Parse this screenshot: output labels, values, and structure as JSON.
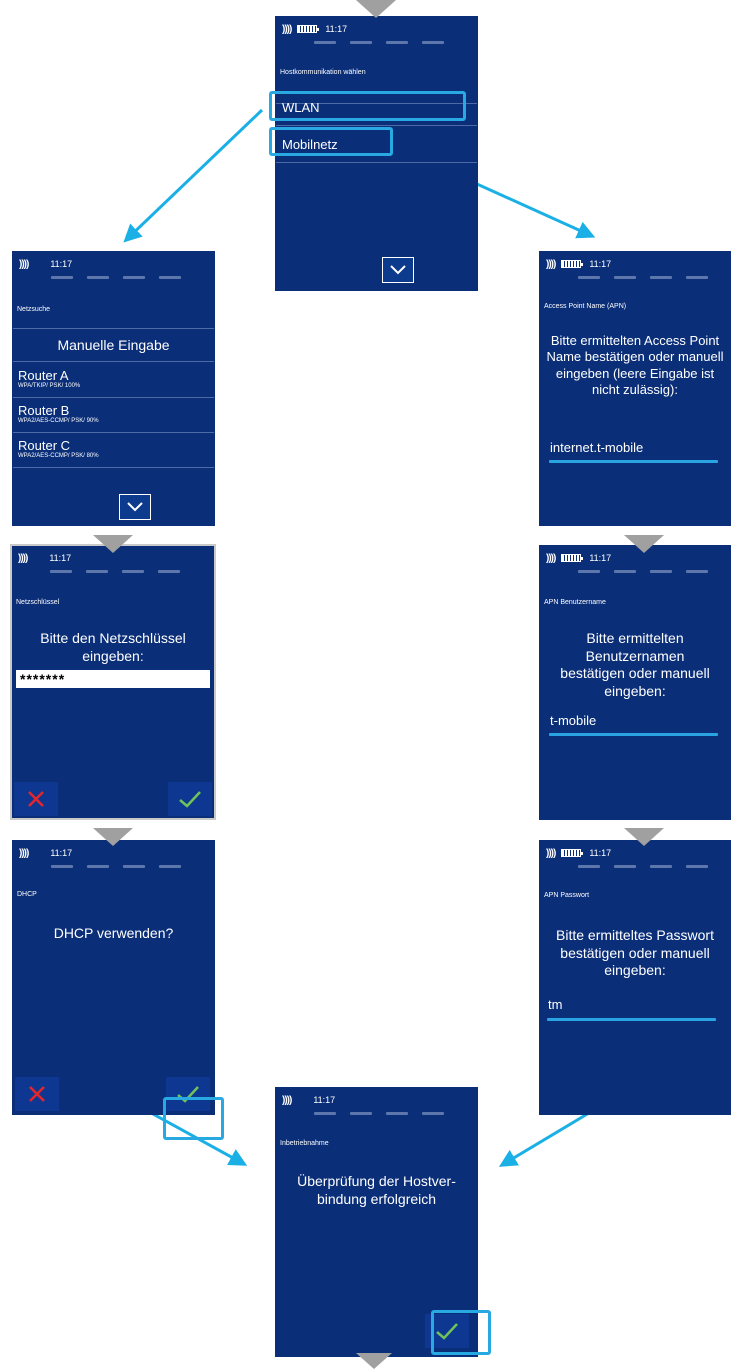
{
  "colors": {
    "screen_bg": "#0a2e78",
    "accent": "#29a9e1",
    "arrow": "#1ab0e6",
    "cancel_red": "#e3262b",
    "confirm_green": "#6ec35a",
    "step_triangle": "#a0a0a0"
  },
  "status": {
    "clock": "11:17",
    "nfc_glyph": "))))",
    "battery_icon": "battery-icon"
  },
  "screens": {
    "host": {
      "title": "Hostkommunikation wählen",
      "options": [
        "WLAN",
        "Mobilnetz"
      ],
      "nav_icon": "chevron-down-icon"
    },
    "wifi_search": {
      "title": "Netzsuche",
      "manual_entry": "Manuelle Eingabe",
      "routers": [
        {
          "name": "Router A",
          "detail": "WPA/TKIP/ PSK/ 100%"
        },
        {
          "name": "Router B",
          "detail": "WPA2/AES-CCMP/ PSK/ 90%"
        },
        {
          "name": "Router C",
          "detail": "WPA2/AES-CCMP/ PSK/ 80%"
        }
      ],
      "nav_icon": "chevron-down-icon"
    },
    "apn": {
      "title": "Access Point Name (APN)",
      "prompt": "Bitte ermittelten Access Point Name bestätigen oder manuell eingeben (leere Eingabe ist nicht zulässig):",
      "value": "internet.t-mobile"
    },
    "netkey": {
      "title": "Netzschlüssel",
      "prompt": "Bitte den Netzschlüssel eingeben:",
      "value": "*******",
      "cancel_icon": "close-icon",
      "confirm_icon": "check-icon"
    },
    "apn_user": {
      "title": "APN Benutzername",
      "prompt": "Bitte ermittelten Benutzernamen bestätigen oder manuell eingeben:",
      "value": "t-mobile"
    },
    "dhcp": {
      "title": "DHCP",
      "prompt": "DHCP verwenden?",
      "cancel_icon": "close-icon",
      "confirm_icon": "check-icon"
    },
    "apn_password": {
      "title": "APN Passwort",
      "prompt": "Bitte ermitteltes Passwort bestätigen oder manuell eingeben:",
      "value": "tm"
    },
    "commissioning": {
      "title": "Inbetriebnahme",
      "prompt": "Überprüfung der Hostver-bindung erfolgreich",
      "confirm_icon": "check-icon"
    }
  }
}
